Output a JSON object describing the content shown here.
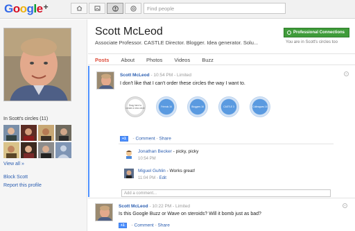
{
  "topbar": {
    "logo_google": "Google",
    "logo_plus": "+",
    "search_placeholder": "Find people",
    "nav_icons": [
      "home-icon",
      "photos-icon",
      "profile-icon",
      "circles-icon"
    ]
  },
  "sidebar": {
    "circles_label": "In Scott's circles (11)",
    "view_all": "View all »",
    "block": "Block Scott",
    "report": "Report this profile"
  },
  "profile": {
    "name": "Scott McLeod",
    "tagline": "Associate Professor. CASTLE Director. Blogger. Idea generator. Solu...",
    "pro_button": "Professional Connections",
    "in_circles_text": "You are in Scott's circles too"
  },
  "tabs": [
    "Posts",
    "About",
    "Photos",
    "Videos",
    "Buzz"
  ],
  "active_tab": "Posts",
  "post1": {
    "author": "Scott McLeod",
    "time": "10:54 PM",
    "visibility": "Limited",
    "text": "I don't like that I can't order these circles the way I want to.",
    "circles": [
      {
        "label": "Drag here to create a new circle"
      },
      {
        "label": "Friends 16"
      },
      {
        "label": "Bloggers 16"
      },
      {
        "label": "CASTLE 3"
      },
      {
        "label": "Colleagues 16"
      }
    ],
    "plus_label": "+1",
    "comment_label": "Comment",
    "share_label": "Share",
    "comments": [
      {
        "author": "Jonathan Becker",
        "text": " - picky, picky",
        "time": "10:54 PM",
        "edit": ""
      },
      {
        "author": "Miguel Guhlin",
        "text": " - Works great!",
        "time": "11:04 PM",
        "edit": "Edit"
      }
    ],
    "add_comment_placeholder": "Add a comment..."
  },
  "post2": {
    "author": "Scott McLeod",
    "time": "10:22 PM",
    "visibility": "Limited",
    "text": "Is this Google Buzz or Wave on steroids? Will it bomb just as bad?",
    "plus_label": "+1",
    "comment_label": "Comment",
    "share_label": "Share"
  },
  "colors": {
    "google_blue": "#3369e8",
    "google_red": "#d50f25",
    "google_yellow": "#eeb211",
    "google_green": "#009925",
    "link": "#2a5db0",
    "active_tab": "#dd4b39",
    "pro_button": "#3f9b3a",
    "circle_blue": "#5a9ae0"
  }
}
